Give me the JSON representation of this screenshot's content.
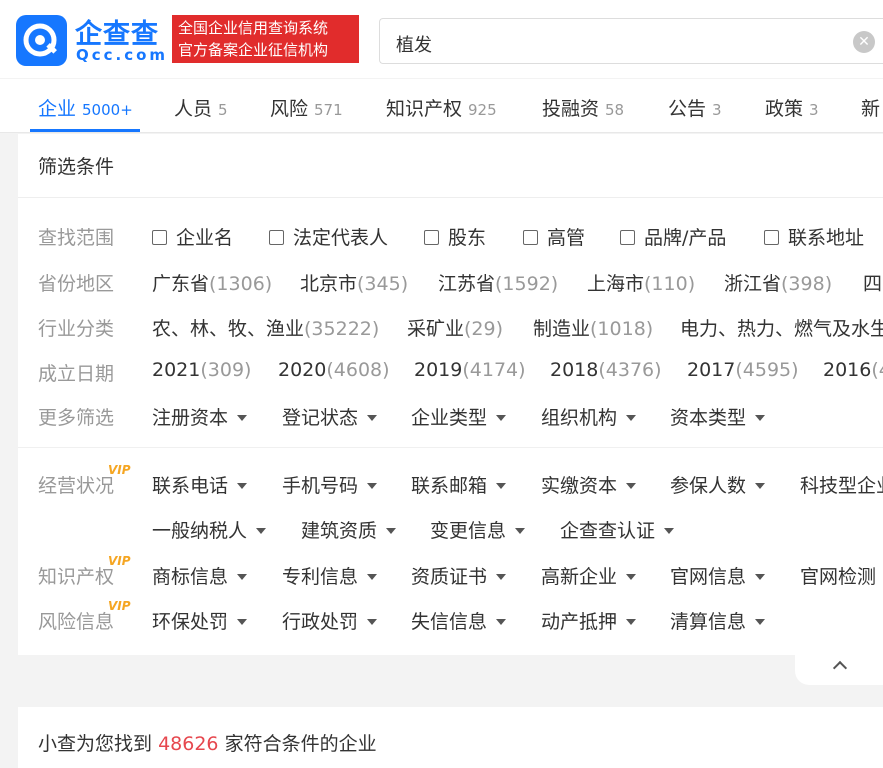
{
  "brand": {
    "name": "企查查",
    "domain": "Qcc.com",
    "badge_line1": "全国企业信用查询系统",
    "badge_line2": "官方备案企业征信机构",
    "color": "#1677ff"
  },
  "search": {
    "value": "植发"
  },
  "tabs": [
    {
      "label": "企业",
      "count": "5000+"
    },
    {
      "label": "人员",
      "count": "5"
    },
    {
      "label": "风险",
      "count": "571"
    },
    {
      "label": "知识产权",
      "count": "925"
    },
    {
      "label": "投融资",
      "count": "58"
    },
    {
      "label": "公告",
      "count": "3"
    },
    {
      "label": "政策",
      "count": "3"
    },
    {
      "label": "新",
      "count": ""
    }
  ],
  "filter": {
    "title": "筛选条件",
    "scope": {
      "label": "查找范围",
      "options": [
        "企业名",
        "法定代表人",
        "股东",
        "高管",
        "品牌/产品",
        "联系地址"
      ]
    },
    "province": {
      "label": "省份地区",
      "items": [
        {
          "name": "广东省",
          "count": "(1306)"
        },
        {
          "name": "北京市",
          "count": "(345)"
        },
        {
          "name": "江苏省",
          "count": "(1592)"
        },
        {
          "name": "上海市",
          "count": "(110)"
        },
        {
          "name": "浙江省",
          "count": "(398)"
        },
        {
          "name": "四",
          "count": ""
        }
      ]
    },
    "industry": {
      "label": "行业分类",
      "items": [
        {
          "name": "农、林、牧、渔业",
          "count": "(35222)"
        },
        {
          "name": "采矿业",
          "count": "(29)"
        },
        {
          "name": "制造业",
          "count": "(1018)"
        },
        {
          "name": "电力、热力、燃气及水生",
          "count": ""
        }
      ]
    },
    "founded": {
      "label": "成立日期",
      "items": [
        {
          "name": "2021",
          "count": "(309)"
        },
        {
          "name": "2020",
          "count": "(4608)"
        },
        {
          "name": "2019",
          "count": "(4174)"
        },
        {
          "name": "2018",
          "count": "(4376)"
        },
        {
          "name": "2017",
          "count": "(4595)"
        },
        {
          "name": "2016",
          "count": "(4"
        }
      ]
    },
    "more": {
      "label": "更多筛选",
      "dropdowns": [
        "注册资本",
        "登记状态",
        "企业类型",
        "组织机构",
        "资本类型"
      ]
    },
    "vip_tag": "VIP",
    "business": {
      "label": "经营状况",
      "dropdowns": [
        "联系电话",
        "手机号码",
        "联系邮箱",
        "实缴资本",
        "参保人数",
        "科技型企业"
      ],
      "dropdowns2": [
        "一般纳税人",
        "建筑资质",
        "变更信息",
        "企查查认证"
      ]
    },
    "ip": {
      "label": "知识产权",
      "dropdowns": [
        "商标信息",
        "专利信息",
        "资质证书",
        "高新企业",
        "官网信息"
      ],
      "plain": "官网检测"
    },
    "risk": {
      "label": "风险信息",
      "dropdowns": [
        "环保处罚",
        "行政处罚",
        "失信信息",
        "动产抵押",
        "清算信息"
      ]
    }
  },
  "result": {
    "prefix": "小查为您找到",
    "count": "48626",
    "suffix": "家符合条件的企业",
    "highlight_color": "#e6474e"
  }
}
